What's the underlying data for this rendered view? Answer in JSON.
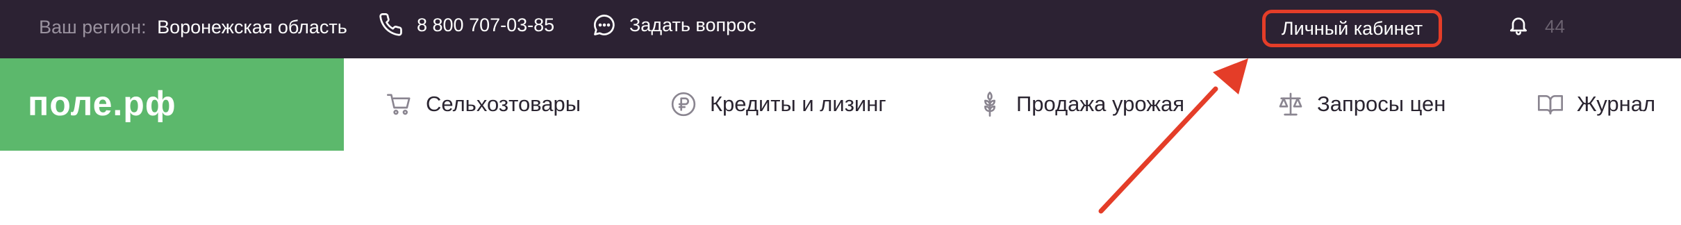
{
  "topbar": {
    "region_label": "Ваш регион:",
    "region_value": "Воронежская область",
    "phone": "8 800 707-03-85",
    "ask_question": "Задать вопрос",
    "cabinet": "Личный кабинет",
    "notifications_count": "44"
  },
  "logo": {
    "text": "поле.рф"
  },
  "nav": {
    "items": [
      {
        "label": "Сельхозтовары",
        "icon": "cart-icon"
      },
      {
        "label": "Кредиты и лизинг",
        "icon": "ruble-icon"
      },
      {
        "label": "Продажа урожая",
        "icon": "wheat-icon"
      },
      {
        "label": "Запросы цен",
        "icon": "scales-icon"
      },
      {
        "label": "Журнал",
        "icon": "book-icon"
      }
    ]
  },
  "colors": {
    "topbar_bg": "#2c2233",
    "logo_bg": "#5cb86c",
    "highlight": "#e43d28",
    "nav_icon": "#8a8590"
  }
}
